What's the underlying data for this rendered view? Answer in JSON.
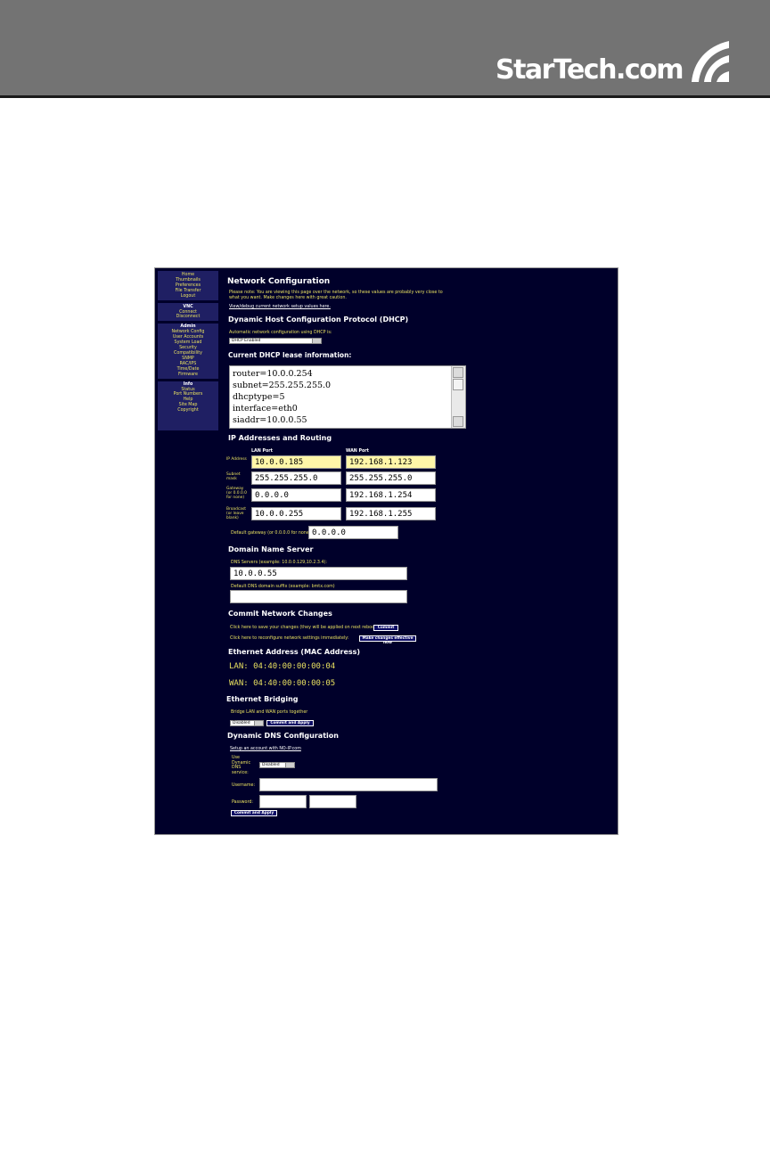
{
  "brand": {
    "name": "StarTech.com"
  },
  "sidebar": {
    "top_items": [
      {
        "label": "Home"
      },
      {
        "label": "Thumbnails"
      },
      {
        "label": "Preferences"
      },
      {
        "label": "File Transfer"
      },
      {
        "label": "Logout"
      }
    ],
    "vnc_header": "VNC",
    "vnc_items": [
      {
        "label": "Connect"
      },
      {
        "label": "Disconnect"
      }
    ],
    "admin_header": "Admin",
    "admin_items": [
      {
        "label": "Network Config"
      },
      {
        "label": "User Accounts"
      },
      {
        "label": "System Load"
      },
      {
        "label": "Security"
      },
      {
        "label": "Compatibility"
      },
      {
        "label": "SNMP"
      },
      {
        "label": "RAC/IPS"
      },
      {
        "label": "Time/Date"
      },
      {
        "label": "Firmware"
      }
    ],
    "info_header": "Info",
    "info_items": [
      {
        "label": "Status"
      },
      {
        "label": "Port Numbers"
      },
      {
        "label": "Help"
      },
      {
        "label": "Site Map"
      },
      {
        "label": "Copyright"
      }
    ]
  },
  "page": {
    "title": "Network Configuration",
    "note": "Please note: You are viewing this page over the network, so these values are probably very close to what you want. Make changes here with great caution.",
    "view_link": "View/debug current network setup values here.",
    "dhcp": {
      "heading": "Dynamic Host Configuration Protocol (DHCP)",
      "label": "Automatic network configuration using DHCP is:",
      "select_value": "DHCP Enabled",
      "lease_heading": "Current DHCP lease information:",
      "lease_lines": [
        "router=10.0.0.254",
        "subnet=255.255.255.0",
        "dhcptype=5",
        "interface=eth0",
        "siaddr=10.0.0.55"
      ]
    },
    "ip": {
      "heading": "IP Addresses and Routing",
      "col_lan": "LAN Port",
      "col_wan": "WAN Port",
      "rows": [
        {
          "label": "IP Address",
          "lan": "10.0.0.185",
          "wan": "192.168.1.123"
        },
        {
          "label": "Subnet mask",
          "lan": "255.255.255.0",
          "wan": "255.255.255.0"
        },
        {
          "label": "Gateway (or 0.0.0.0 for none)",
          "lan": "0.0.0.0",
          "wan": "192.168.1.254"
        },
        {
          "label": "Broadcast (or leave blank)",
          "lan": "10.0.0.255",
          "wan": "192.168.1.255"
        }
      ],
      "default_gw_label": "Default gateway (or 0.0.0.0 for none):",
      "default_gw_value": "0.0.0.0"
    },
    "dns": {
      "heading": "Domain Name Server",
      "servers_label": "DNS Servers (example: 10.0.0.129,10.2.3.4):",
      "servers_value": "10.0.0.55",
      "suffix_label": "Default DNS domain suffix (example: bmtx.com)",
      "suffix_value": ""
    },
    "commit": {
      "heading": "Commit Network Changes",
      "save_text": "Click here to save your changes (they will be applied on next reboot).",
      "commit_button": "Commit",
      "apply_text": "Click here to reconfigure network settings immediately:",
      "apply_button": "Make changes effective now"
    },
    "mac": {
      "heading": "Ethernet Address (MAC Address)",
      "lan": "LAN: 04:40:00:00:00:04",
      "wan": "WAN: 04:40:00:00:00:05"
    },
    "bridge": {
      "heading": "Ethernet Bridging",
      "label": "Bridge LAN and WAN ports together",
      "select_value": "Disabled",
      "button": "Commit and Apply"
    },
    "ddns": {
      "heading": "Dynamic DNS Configuration",
      "link": "Setup an account with NO-IP.com",
      "use_label": "Use Dynamic DNS service:",
      "select_value": "Disabled",
      "username_label": "Username:",
      "password_label": "Password:",
      "button": "Commit and Apply"
    }
  }
}
